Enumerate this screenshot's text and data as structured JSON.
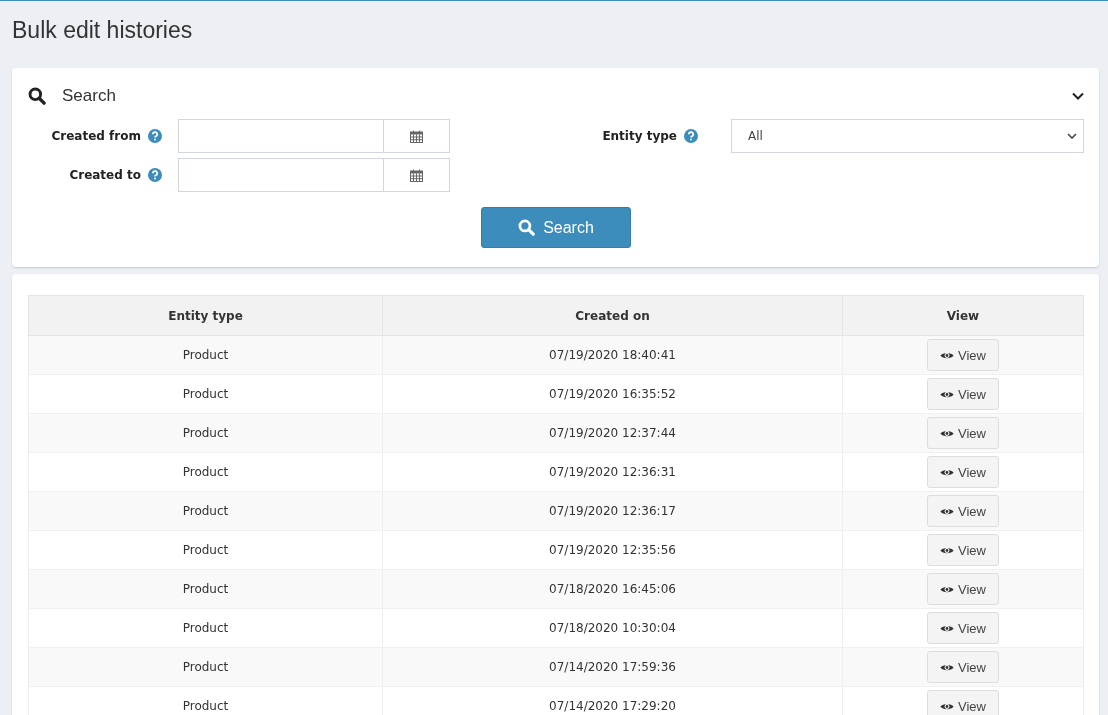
{
  "page_title": "Bulk edit histories",
  "search_panel": {
    "title": "Search",
    "expanded": true,
    "fields": [
      {
        "label": "Created from",
        "kind": "date"
      },
      {
        "label": "Created to",
        "kind": "date"
      }
    ],
    "entity_type": {
      "label": "Entity type",
      "value": "All"
    },
    "button": "Search"
  },
  "table": {
    "columns": [
      "Entity type",
      "Created on",
      "View"
    ],
    "rows": [
      {
        "entity_type": "Product",
        "created_on": "07/19/2020 18:40:41",
        "action": "View"
      },
      {
        "entity_type": "Product",
        "created_on": "07/19/2020 16:35:52",
        "action": "View"
      },
      {
        "entity_type": "Product",
        "created_on": "07/19/2020 12:37:44",
        "action": "View"
      },
      {
        "entity_type": "Product",
        "created_on": "07/19/2020 12:36:31",
        "action": "View"
      },
      {
        "entity_type": "Product",
        "created_on": "07/19/2020 12:36:17",
        "action": "View"
      },
      {
        "entity_type": "Product",
        "created_on": "07/19/2020 12:35:56",
        "action": "View"
      },
      {
        "entity_type": "Product",
        "created_on": "07/18/2020 16:45:06",
        "action": "View"
      },
      {
        "entity_type": "Product",
        "created_on": "07/18/2020 10:30:04",
        "action": "View"
      },
      {
        "entity_type": "Product",
        "created_on": "07/14/2020 17:59:36",
        "action": "View"
      },
      {
        "entity_type": "Product",
        "created_on": "07/14/2020 17:29:20",
        "action": "View"
      }
    ]
  }
}
